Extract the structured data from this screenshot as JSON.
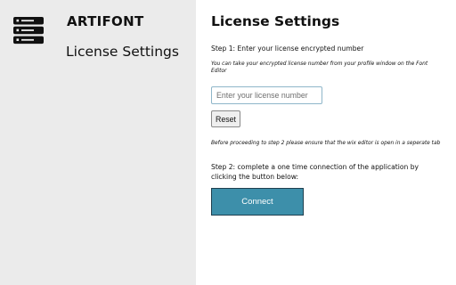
{
  "sidebar": {
    "logo_icon": "server-stack-icon",
    "brand": "ARTIFONT",
    "title": "License Settings"
  },
  "main": {
    "title": "License Settings",
    "step1_label": "Step 1: Enter your license encrypted number",
    "step1_hint": "You can take your encrypted license number from your profile window on the Font Editor",
    "license_input": {
      "value": "",
      "placeholder": "Enter your license number"
    },
    "reset_label": "Reset",
    "step2_hint": "Before proceeding to step 2 please ensure that the wix editor is open in a seperate tab",
    "step2_label": "Step 2: complete a one time connection of the application by clicking the button below:",
    "connect_label": "Connect"
  },
  "colors": {
    "sidebar_bg": "#ebebeb",
    "connect_bg": "#3d8faa",
    "input_border": "#8fb6c9"
  }
}
